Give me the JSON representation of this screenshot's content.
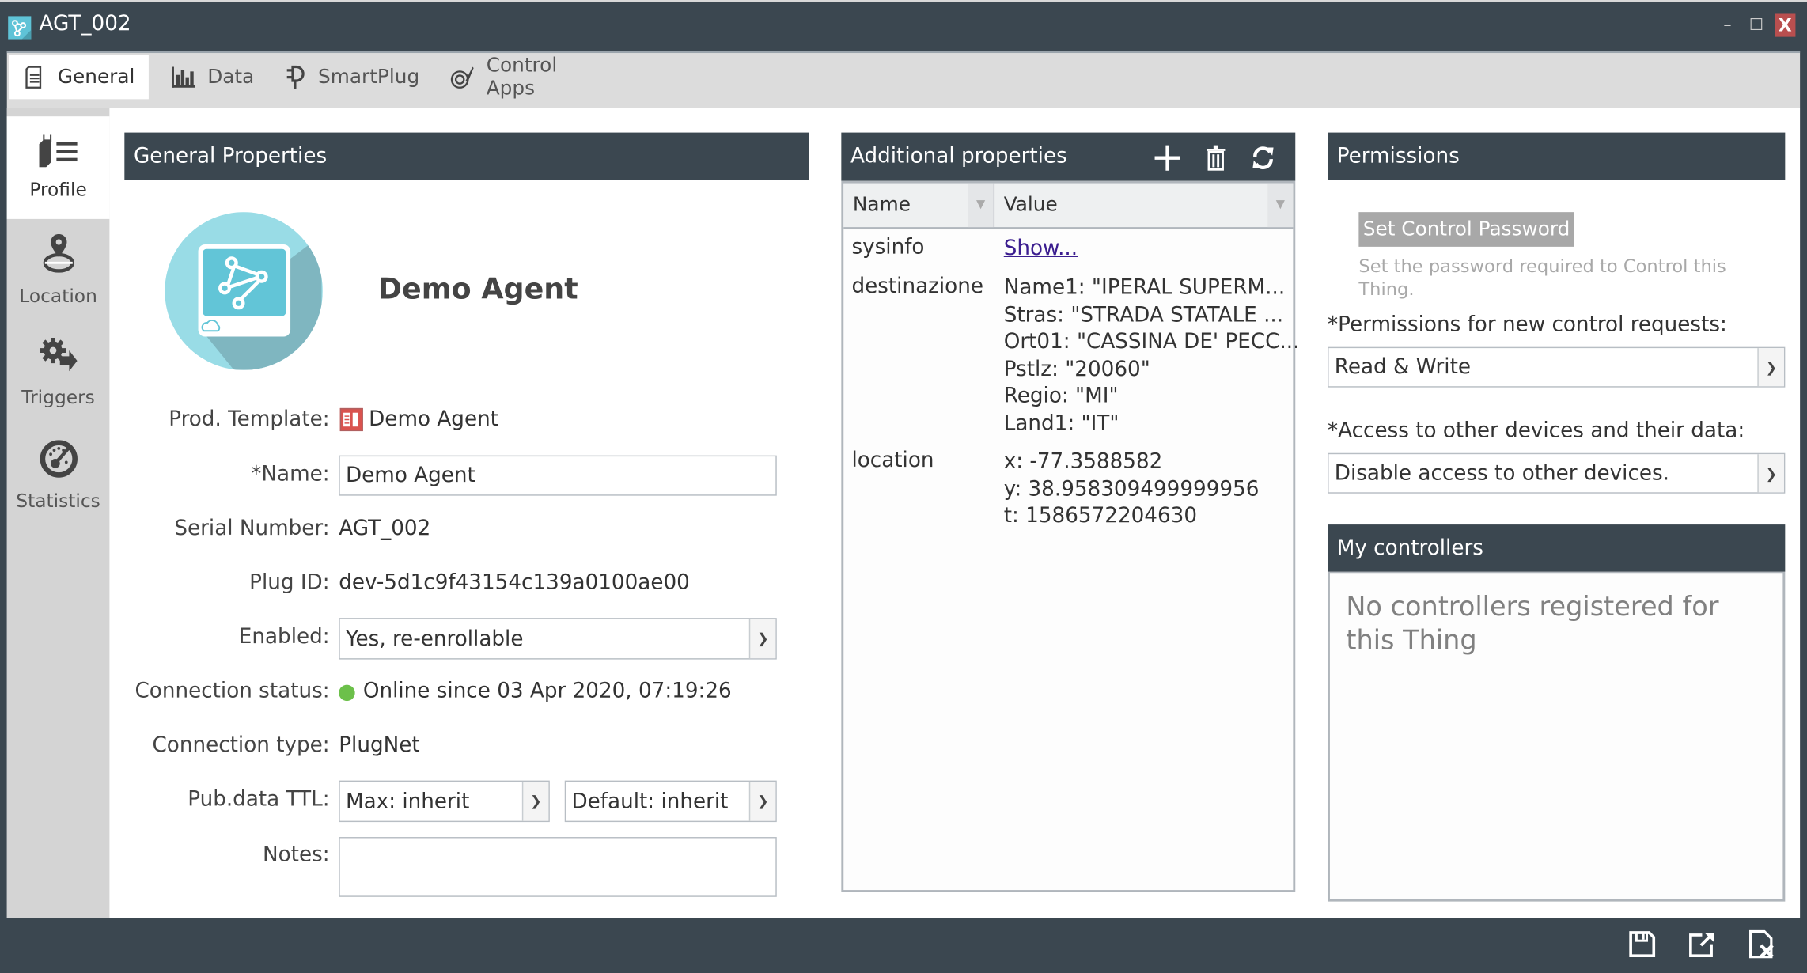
{
  "window": {
    "title": "AGT_002",
    "icon": "agent-network-icon",
    "controls": {
      "minimize": "–",
      "maximize": "☐",
      "close": "X"
    }
  },
  "tabs": [
    {
      "label": "General",
      "icon": "document-list-icon",
      "active": true
    },
    {
      "label": "Data",
      "icon": "bar-chart-icon",
      "active": false
    },
    {
      "label": "SmartPlug",
      "icon": "plug-icon",
      "active": false
    },
    {
      "label": "Control Apps",
      "icon": "brush-app-icon",
      "active": false
    }
  ],
  "sidebar": {
    "items": [
      {
        "label": "Profile",
        "icon": "profile-list-icon",
        "active": true
      },
      {
        "label": "Location",
        "icon": "location-pin-icon",
        "active": false
      },
      {
        "label": "Triggers",
        "icon": "gear-arrow-icon",
        "active": false
      },
      {
        "label": "Statistics",
        "icon": "gauge-icon",
        "active": false
      }
    ]
  },
  "general": {
    "title": "General Properties",
    "agent_name": "Demo Agent",
    "fields": {
      "prod_template": {
        "label": "Prod. Template:",
        "value": "Demo Agent"
      },
      "name": {
        "label": "*Name:",
        "value": "Demo Agent"
      },
      "serial": {
        "label": "Serial Number:",
        "value": "AGT_002"
      },
      "plug_id": {
        "label": "Plug ID:",
        "value": "dev-5d1c9f43154c139a0100ae00"
      },
      "enabled": {
        "label": "Enabled:",
        "value": "Yes, re-enrollable"
      },
      "connection_status": {
        "label": "Connection status:",
        "value": "Online since 03 Apr 2020, 07:19:26",
        "color": "#6cc04a"
      },
      "connection_type": {
        "label": "Connection type:",
        "value": "PlugNet"
      },
      "pub_ttl": {
        "label": "Pub.data TTL:",
        "max": "Max: inherit",
        "default": "Default: inherit"
      },
      "notes": {
        "label": "Notes:",
        "value": ""
      }
    }
  },
  "additional": {
    "title": "Additional properties",
    "columns": {
      "name": "Name",
      "value": "Value"
    },
    "rows": [
      {
        "name": "sysinfo",
        "value": "Show...",
        "link": true
      },
      {
        "name": "destinazione",
        "value": "Name1: \"IPERAL SUPERM...\nStras: \"STRADA STATALE ...\nOrt01: \"CASSINA DE' PECC...\nPstlz: \"20060\"\nRegio: \"MI\"\nLand1: \"IT\"",
        "link": false
      },
      {
        "name": "location",
        "value": "x: -77.3588582\ny: 38.958309499999956\nt: 1586572204630",
        "link": false
      }
    ]
  },
  "permissions": {
    "title": "Permissions",
    "set_password_button": "Set Control Password",
    "set_password_hint": "Set the password required to Control this Thing.",
    "new_requests_label": "*Permissions for new control requests:",
    "new_requests_value": "Read & Write",
    "access_label": "*Access to other devices and their data:",
    "access_value": "Disable access to other devices."
  },
  "controllers": {
    "title": "My controllers",
    "empty_text": "No controllers registered for this Thing"
  },
  "footer": {
    "buttons": [
      "save-icon",
      "export-icon",
      "discard-icon"
    ]
  },
  "colors": {
    "header_bg": "#3b4750",
    "accent_cyan": "#5fc3d7",
    "close_red": "#b94f4f",
    "online_green": "#6cc04a",
    "link_purple": "#3b1d8f"
  }
}
